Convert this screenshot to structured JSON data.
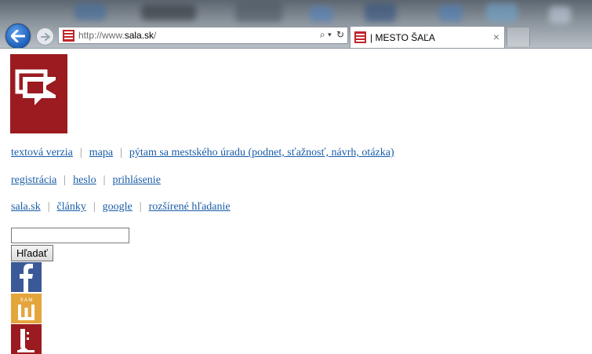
{
  "browser": {
    "url_prefix": "http://www.",
    "url_domain": "sala.sk",
    "url_suffix": "/",
    "search_glyph": "⌕ ▾",
    "refresh_glyph": "↻",
    "tab_title": "| MESTO ŠAĽA",
    "tab_close_glyph": "×"
  },
  "nav": {
    "row1": [
      "textová verzia",
      "mapa",
      "pýtam sa mestského úradu (podnet, sťažnosť, návrh, otázka)"
    ],
    "row2": [
      "registrácia",
      "heslo",
      "prihlásenie"
    ],
    "row3": [
      "sala.sk",
      "články",
      "google",
      "rozšírené hľadanie"
    ],
    "separator": "|"
  },
  "search": {
    "value": "",
    "button_label": "Hľadať"
  },
  "social": {
    "sam_label": "S A M"
  },
  "colors": {
    "brand_red": "#9b1b20",
    "link_blue": "#1a5ca8",
    "facebook_blue": "#3b5998",
    "sam_orange": "#e5a53d"
  }
}
